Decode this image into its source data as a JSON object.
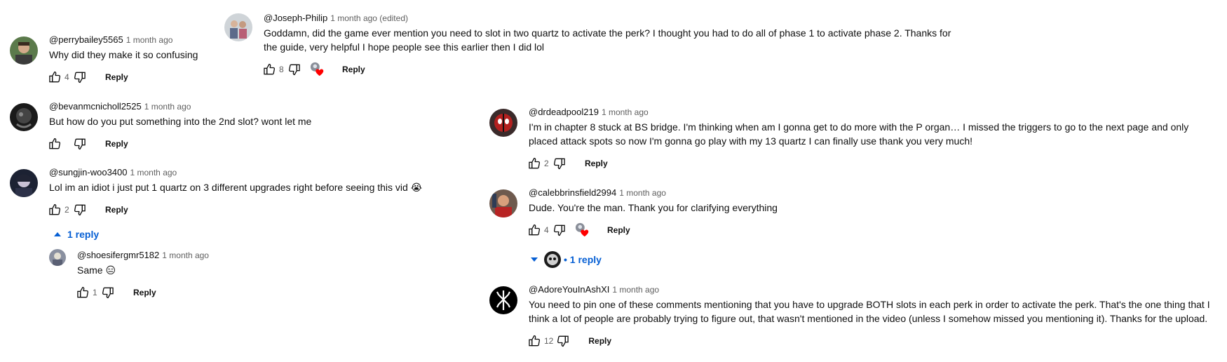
{
  "comments_left": [
    {
      "author": "@perrybailey5565",
      "time": "1 month ago",
      "text": "Why did they make it so confusing",
      "likes": "4",
      "reply": "Reply"
    },
    {
      "author": "@bevanmcnicholl2525",
      "time": "1 month ago",
      "text": "But how do you put something into the 2nd slot? wont let me",
      "likes": "",
      "reply": "Reply"
    },
    {
      "author": "@sungjin-woo3400",
      "time": "1 month ago",
      "text": "Lol im an idiot i just put 1 quartz on 3 different upgrades right before seeing this vid 😭",
      "likes": "2",
      "reply": "Reply",
      "replies_toggle": "1 reply"
    },
    {
      "author": "@shoesifergmr5182",
      "time": "1 month ago",
      "text": "Same 😑",
      "likes": "1",
      "reply": "Reply"
    }
  ],
  "comments_mid": [
    {
      "author": "@Joseph-Philip",
      "time": "1 month ago (edited)",
      "text": "Goddamn, did the game ever mention you need to slot in two quartz to activate the perk? I thought you had to do all of phase 1 to activate phase 2. Thanks for the guide, very helpful I hope people see this earlier then I did lol",
      "likes": "8",
      "reply": "Reply"
    }
  ],
  "comments_right": [
    {
      "author": "@drdeadpool219",
      "time": "1 month ago",
      "text": "I'm in chapter 8 stuck at BS bridge. I'm thinking when am I gonna get to do more with the P organ… I missed the triggers to go to the next page and only placed attack spots so now I'm gonna go play with my 13 quartz I can finally use thank you very much!",
      "likes": "2",
      "reply": "Reply"
    },
    {
      "author": "@calebbrinsfield2994",
      "time": "1 month ago",
      "text": "Dude. You're the man. Thank you for clarifying everything",
      "likes": "4",
      "reply": "Reply",
      "replies_toggle": "• 1 reply"
    },
    {
      "author": "@AdoreYouInAshXI",
      "time": "1 month ago",
      "text": "You need to pin one of these comments mentioning that you have to upgrade BOTH slots in each perk in order to activate the perk. That's the one thing that I think a lot of people are probably trying to figure out, that wasn't mentioned in the video (unless I somehow missed you mentioning it). Thanks for the upload.",
      "likes": "12",
      "reply": "Reply"
    }
  ],
  "colors": {
    "link_blue": "#065fd4",
    "text": "#0f0f0f",
    "meta": "#606060",
    "heart": "#ff0000"
  },
  "icons": [
    "thumb-up-icon",
    "thumb-down-icon",
    "creator-heart-icon",
    "caret-up-icon",
    "caret-down-icon"
  ]
}
